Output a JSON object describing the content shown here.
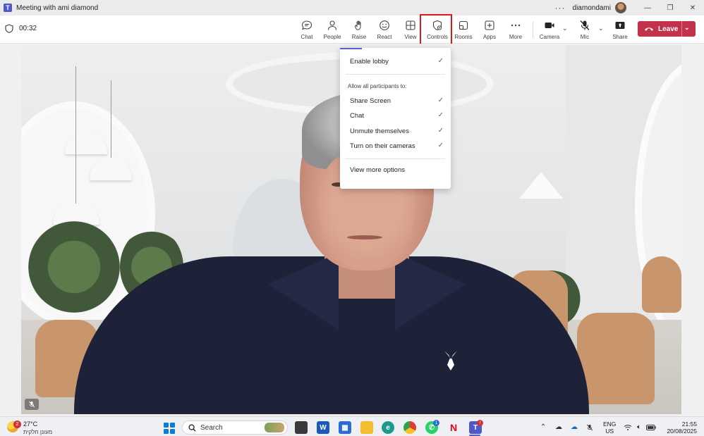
{
  "window": {
    "title": "Meeting with ami diamond",
    "more_glyph": "···",
    "user_name": "diamondami",
    "controls": {
      "minimize": "—",
      "maximize": "❐",
      "close": "✕"
    }
  },
  "toolbar": {
    "timer": "00:32",
    "buttons": [
      {
        "label": "Chat",
        "icon": "chat-bubble-icon"
      },
      {
        "label": "People",
        "icon": "people-icon"
      },
      {
        "label": "Raise",
        "icon": "raise-hand-icon"
      },
      {
        "label": "React",
        "icon": "smile-icon"
      },
      {
        "label": "View",
        "icon": "grid-view-icon"
      },
      {
        "label": "Controls",
        "icon": "shield-controls-icon"
      },
      {
        "label": "Rooms",
        "icon": "rooms-icon"
      },
      {
        "label": "Apps",
        "icon": "add-apps-icon"
      },
      {
        "label": "More",
        "icon": "more-dots-icon"
      },
      {
        "label": "Camera",
        "icon": "camera-icon"
      },
      {
        "label": "Mic",
        "icon": "mic-off-icon"
      },
      {
        "label": "Share",
        "icon": "share-screen-icon"
      }
    ],
    "leave_label": "Leave",
    "leave_color": "#c4314b"
  },
  "controls_menu": {
    "enable_lobby": "Enable lobby",
    "section_header": "Allow all participants to:",
    "options": [
      "Share Screen",
      "Chat",
      "Unmute themselves",
      "Turn on their cameras"
    ],
    "check_glyph": "✓",
    "more_options": "View more options",
    "accent_color": "#5b5fc7",
    "highlight_color": "#e0181c"
  },
  "taskbar": {
    "weather_badge": "2",
    "weather_temp": "27°C",
    "weather_desc": "מעונן חלקית",
    "search_label": "Search",
    "whatsapp_badge": "1",
    "teams_badge": "!",
    "language_line1": "ENG",
    "language_line2": "US",
    "time": "21:55",
    "date": "20/08/2025"
  }
}
